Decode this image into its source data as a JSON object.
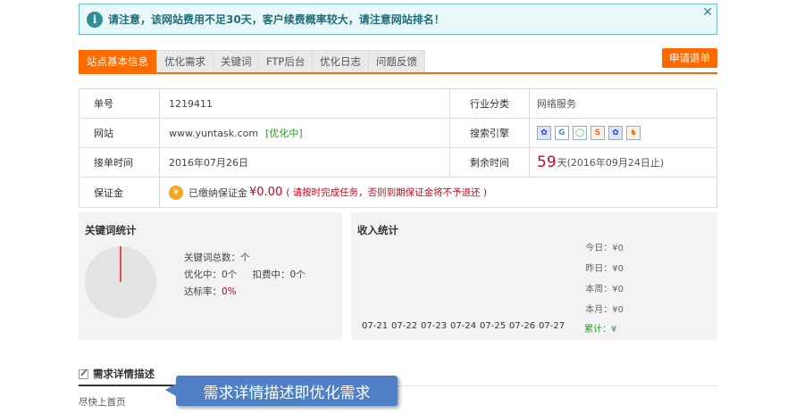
{
  "notice": {
    "icon": "info-icon",
    "text": "请注意，该网站费用不足30天，客户续费概率较大，请注意网站排名！",
    "close": "✕"
  },
  "tabs": [
    {
      "label": "站点基本信息",
      "active": true
    },
    {
      "label": "优化需求",
      "active": false
    },
    {
      "label": "关键词",
      "active": false
    },
    {
      "label": "FTP后台",
      "active": false
    },
    {
      "label": "优化日志",
      "active": false
    },
    {
      "label": "问题反馈",
      "active": false
    }
  ],
  "refund_button": "申请退单",
  "info": {
    "order_no_label": "单号",
    "order_no": "1219411",
    "industry_label": "行业分类",
    "industry": "网络服务",
    "site_label": "网站",
    "site": "www.yuntask.com",
    "site_status": "[优化中]",
    "engine_label": "搜索引擎",
    "engines": [
      "baidu-icon",
      "google-icon",
      "360-icon",
      "sogou-icon",
      "baidu-mobile-icon",
      "shenma-icon"
    ],
    "accept_time_label": "接单时间",
    "accept_time": "2016年07月26日",
    "remain_label": "剩余时间",
    "remain_days": "59",
    "remain_suffix": "天(2016年09月24日止)",
    "deposit_label": "保证金",
    "deposit_prefix": "已缴纳保证金",
    "deposit_amount": "¥0.00",
    "deposit_note": "( 请按时完成任务，否则到期保证金将不予退还 )"
  },
  "keyword_stats": {
    "title": "关键词统计",
    "total": "关键词总数：个",
    "optimizing": "优化中：0个",
    "deducting": "扣费中：0个",
    "rate_label": "达标率：",
    "rate_value": "0%"
  },
  "income_stats": {
    "title": "收入统计",
    "today": "今日：¥0",
    "yesterday": "昨日：¥0",
    "week": "本周：¥0",
    "month": "本月：¥0",
    "dates": [
      "07-21",
      "07-22",
      "07-23",
      "07-24",
      "07-25",
      "07-26",
      "07-27"
    ],
    "total": "累计：¥"
  },
  "requirement": {
    "title": "需求详情描述",
    "text": "尽快上首页"
  },
  "callout": "需求详情描述即优化需求",
  "colors": {
    "accent": "#ff6a00",
    "notice_border": "#6cc1c7",
    "callout": "#4f7fc4"
  }
}
